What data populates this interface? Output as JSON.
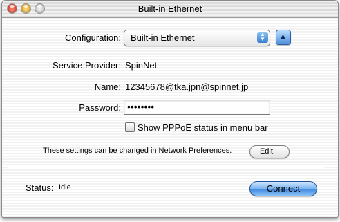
{
  "window": {
    "title": "Built-in Ethernet"
  },
  "configuration": {
    "label": "Configuration:",
    "selected": "Built-in Ethernet"
  },
  "service_provider": {
    "label": "Service Provider:",
    "value": "SpinNet"
  },
  "name": {
    "label": "Name:",
    "value": "12345678@tka.jpn@spinnet.jp"
  },
  "password": {
    "label": "Password:",
    "value": "••••••••"
  },
  "pppoe_status": {
    "label": "Show PPPoE status in menu bar",
    "checked": false
  },
  "settings_note": {
    "text": "These settings can be changed in Network Preferences.",
    "edit_label": "Edit..."
  },
  "status": {
    "label": "Status:",
    "value": "Idle"
  },
  "connect_label": "Connect",
  "colors": {
    "accent": "#3f86dc"
  }
}
